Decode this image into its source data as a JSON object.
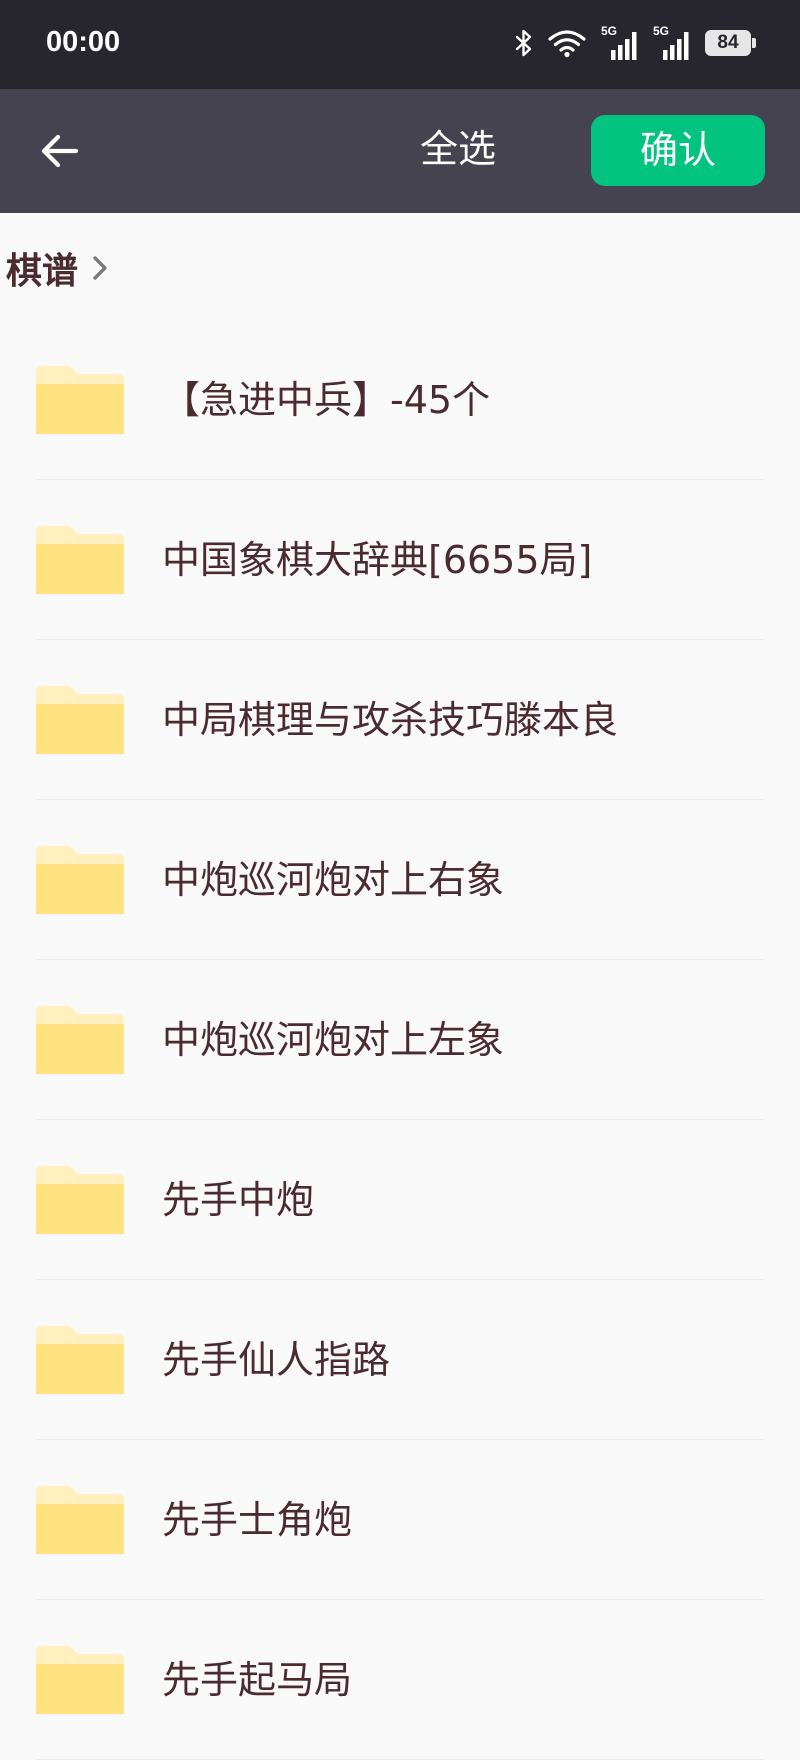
{
  "status_bar": {
    "time": "00:00",
    "icons": [
      "bluetooth-icon",
      "wifi-icon",
      "signal-5g-icon",
      "signal-5g-icon",
      "battery-icon"
    ],
    "signal_1_label": "5G",
    "signal_2_label": "5G",
    "battery_level": "84"
  },
  "header": {
    "back_icon": "arrow-left-icon",
    "select_all_label": "全选",
    "confirm_label": "确认",
    "confirm_color": "#02c37f",
    "background_color": "#44434f"
  },
  "breadcrumb": {
    "items": [
      {
        "label": "棋谱"
      }
    ],
    "separator_icon": "chevron-right-icon"
  },
  "folders": {
    "icon": "folder-icon",
    "items": [
      {
        "name": "【急进中兵】-45个"
      },
      {
        "name": "中国象棋大辞典[6655局]"
      },
      {
        "name": "中局棋理与攻杀技巧滕本良"
      },
      {
        "name": "中炮巡河炮对上右象"
      },
      {
        "name": "中炮巡河炮对上左象"
      },
      {
        "name": "先手中炮"
      },
      {
        "name": "先手仙人指路"
      },
      {
        "name": "先手士角炮"
      },
      {
        "name": "先手起马局"
      }
    ]
  }
}
